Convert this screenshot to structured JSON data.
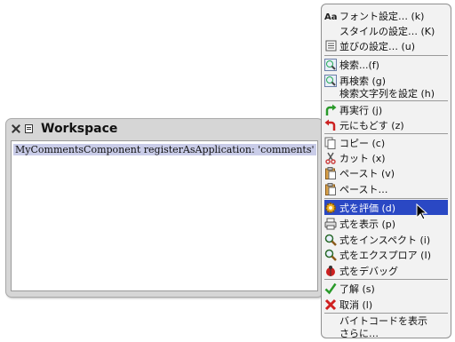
{
  "workspace": {
    "title": "Workspace",
    "code": "MyCommentsComponent registerAsApplication: 'comments'"
  },
  "menu": {
    "items": [
      {
        "label": "フォント設定… (k)",
        "icon": "font-icon"
      },
      {
        "label": "スタイルの設定… (K)",
        "icon": ""
      },
      {
        "label": "並びの設定… (u)",
        "icon": "alignment-icon"
      },
      {
        "label": "検索...(f)",
        "icon": "search-icon"
      },
      {
        "label": "再検索 (g)",
        "icon": "search-again-icon"
      },
      {
        "label": "検索文字列を設定 (h)",
        "icon": ""
      },
      {
        "label": "再実行 (j)",
        "icon": "redo-icon"
      },
      {
        "label": "元にもどす (z)",
        "icon": "undo-icon"
      },
      {
        "label": "コピー (c)",
        "icon": "copy-icon"
      },
      {
        "label": "カット (x)",
        "icon": "cut-icon"
      },
      {
        "label": "ペースト (v)",
        "icon": "paste-icon"
      },
      {
        "label": "ペースト…",
        "icon": "paste-icon"
      },
      {
        "label": "式を評価 (d)",
        "icon": "gear-icon"
      },
      {
        "label": "式を表示 (p)",
        "icon": "print-icon"
      },
      {
        "label": "式をインスペクト (i)",
        "icon": "inspect-icon"
      },
      {
        "label": "式をエクスプロア (I)",
        "icon": "explore-icon"
      },
      {
        "label": "式をデバッグ",
        "icon": "debug-icon"
      },
      {
        "label": "了解 (s)",
        "icon": "check-icon"
      },
      {
        "label": "取消 (l)",
        "icon": "cancel-icon"
      },
      {
        "label": "バイトコードを表示",
        "icon": ""
      },
      {
        "label": "さらに…",
        "icon": ""
      }
    ],
    "highlighted_index": 12
  },
  "colors": {
    "highlight": "#2a48c4",
    "selection": "#c9cce8",
    "menu_background": "#f2f2f2"
  }
}
